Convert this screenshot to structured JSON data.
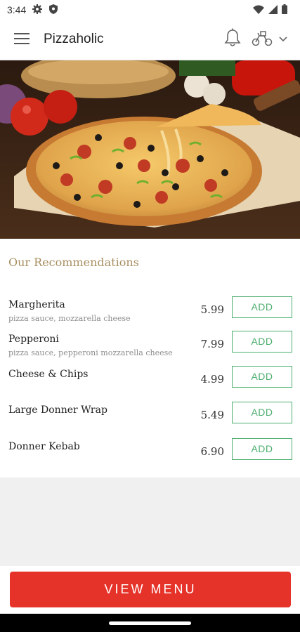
{
  "status_bar": {
    "time": "3:44"
  },
  "app_bar": {
    "title": "Pizzaholic"
  },
  "recommendations": {
    "heading": "Our Recommendations",
    "items": [
      {
        "name": "Margherita",
        "description": "pizza sauce, mozzarella cheese",
        "price": "5.99",
        "action": "ADD"
      },
      {
        "name": "Pepperoni",
        "description": "pizza sauce, pepperoni mozzarella cheese",
        "price": "7.99",
        "action": "ADD"
      },
      {
        "name": "Cheese & Chips",
        "description": "",
        "price": "4.99",
        "action": "ADD"
      },
      {
        "name": "Large Donner Wrap",
        "description": "",
        "price": "5.49",
        "action": "ADD"
      },
      {
        "name": "Donner Kebab",
        "description": "",
        "price": "6.90",
        "action": "ADD"
      }
    ]
  },
  "cta": {
    "label": "VIEW MENU"
  },
  "colors": {
    "accent": "#e6332a",
    "add_button": "#4cae6e",
    "heading": "#a88f62"
  }
}
